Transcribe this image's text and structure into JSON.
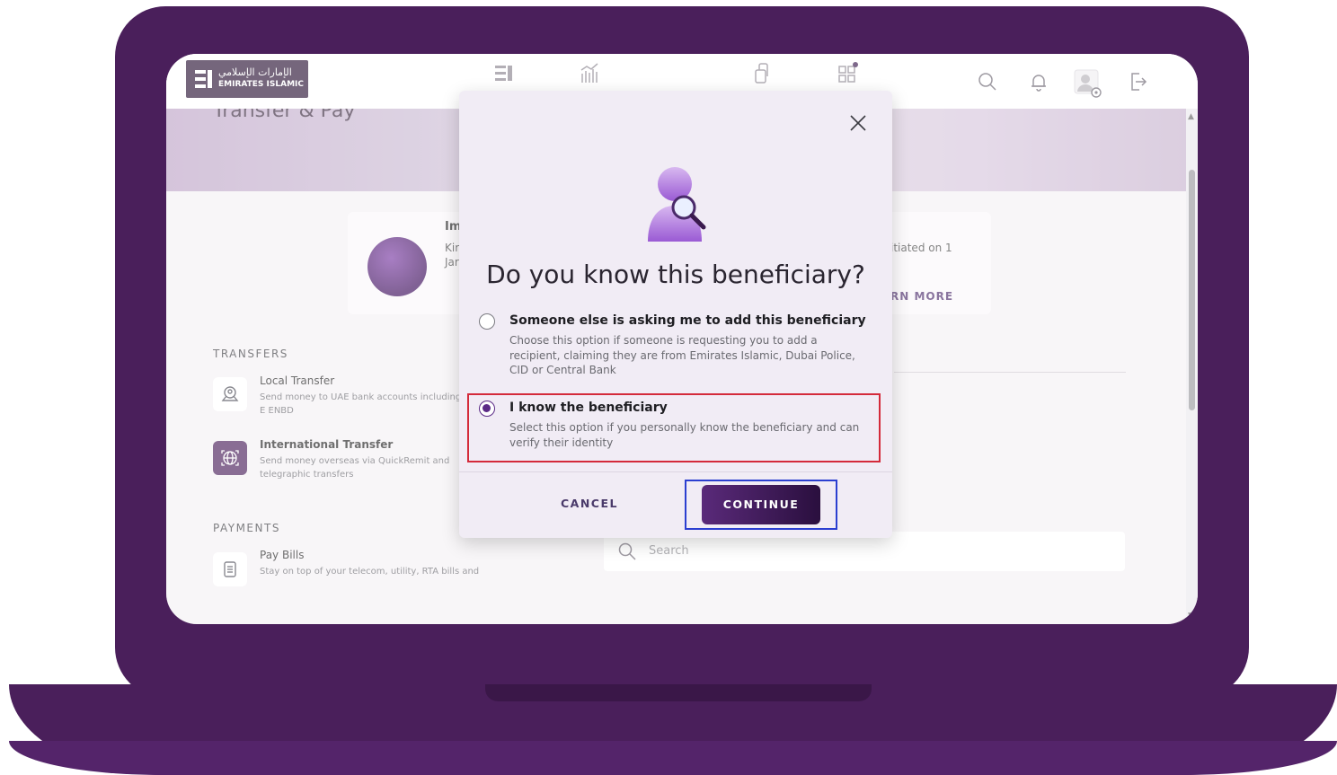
{
  "header": {
    "logo_arabic": "الإمارات الإسلامي",
    "logo_english": "EMIRATES ISLAMIC",
    "nav_icons": [
      "dashboard-icon",
      "chart-icon",
      "transfer-icon",
      "apps-icon"
    ],
    "util_icons": [
      "search-icon",
      "bell-icon",
      "profile-settings-icon",
      "logout-icon"
    ]
  },
  "hero": {
    "title": "Transfer & Pay"
  },
  "promo": {
    "title": "Im",
    "line1": "Kir",
    "line2": "Jar",
    "right_text": "itiated on 1",
    "link": "RN MORE"
  },
  "transfers": {
    "heading": "TRANSFERS",
    "items": [
      {
        "title": "Local Transfer",
        "desc": "Send money to UAE bank accounts including E ENBD",
        "icon": "local-transfer-icon"
      },
      {
        "title": "International Transfer",
        "desc": "Send money overseas via QuickRemit and telegraphic transfers",
        "icon": "globe-icon"
      }
    ]
  },
  "payments": {
    "heading": "PAYMENTS",
    "items": [
      {
        "title": "Pay Bills",
        "desc": "Stay on top of your telecom, utility, RTA bills and",
        "icon": "bill-icon"
      }
    ]
  },
  "search": {
    "placeholder": "Search"
  },
  "modal": {
    "title": "Do you know this beneficiary?",
    "options": [
      {
        "title": "Someone else is asking me to add this beneficiary",
        "desc": "Choose this option if someone is requesting you to add a recipient, claiming they are from Emirates Islamic, Dubai Police, CID or Central Bank",
        "selected": false
      },
      {
        "title": "I know the beneficiary",
        "desc": "Select this option if you personally know the beneficiary and can verify their identity",
        "selected": true
      }
    ],
    "cancel_label": "CANCEL",
    "continue_label": "CONTINUE"
  },
  "colors": {
    "brand_purple": "#4a1f5b",
    "accent": "#5b2a86",
    "highlight_red": "#d42a3a",
    "highlight_blue": "#2b3fd0"
  }
}
